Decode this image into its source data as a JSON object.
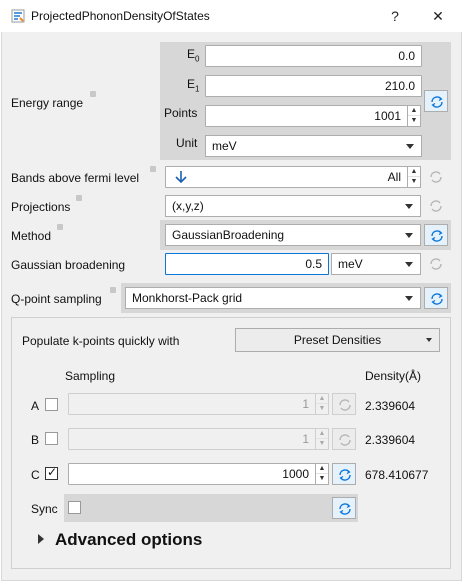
{
  "window": {
    "title": "ProjectedPhononDensityOfStates",
    "help_label": "?",
    "close_label": "✕"
  },
  "energy_range": {
    "label": "Energy range",
    "e0_label": "E",
    "e0_sub": "0",
    "e0_value": "0.0",
    "e1_label": "E",
    "e1_sub": "1",
    "e1_value": "210.0",
    "points_label": "Points",
    "points_value": "1001",
    "unit_label": "Unit",
    "unit_value": "meV"
  },
  "bands_above_fermi": {
    "label": "Bands above fermi level",
    "value": "All"
  },
  "projections": {
    "label": "Projections",
    "value": "(x,y,z)"
  },
  "method": {
    "label": "Method",
    "value": "GaussianBroadening"
  },
  "gaussian_broadening": {
    "label": "Gaussian broadening",
    "value": "0.5",
    "unit": "meV"
  },
  "qpoint_sampling": {
    "label": "Q-point sampling",
    "value": "Monkhorst-Pack grid"
  },
  "kpoints": {
    "populate_label": "Populate k-points quickly with",
    "preset_label": "Preset Densities",
    "sampling_header": "Sampling",
    "density_header": "Density(Å)",
    "rows": [
      {
        "axis": "A",
        "checked": false,
        "value": "1",
        "density": "2.339604"
      },
      {
        "axis": "B",
        "checked": false,
        "value": "1",
        "density": "2.339604"
      },
      {
        "axis": "C",
        "checked": true,
        "value": "1000",
        "density": "678.410677"
      }
    ],
    "sync_label": "Sync",
    "advanced_label": "Advanced options",
    "check_mark": "✓"
  },
  "colors": {
    "accent": "#0a76d8",
    "panel": "#d7d7d7",
    "window_bg": "#f0f0f0"
  }
}
